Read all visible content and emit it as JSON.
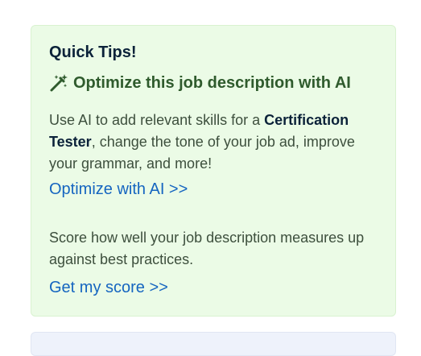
{
  "tips": {
    "title": "Quick Tips!",
    "optimize_heading": "Optimize this job description with AI",
    "optimize_icon": "magic-wand-icon",
    "ai_text_before": "Use AI to add relevant skills for a ",
    "ai_text_bold": "Certification Tester",
    "ai_text_after": ", change the tone of your job ad, improve your grammar, and more!",
    "optimize_link": "Optimize with AI >>",
    "score_text": "Score how well your job description measures up against best practices.",
    "score_link": "Get my score >>"
  },
  "colors": {
    "card_background": "#ebfbe6",
    "heading": "#0b2239",
    "optimize_heading": "#2f5b2d",
    "link": "#1565c0",
    "next_card_background": "#eef2fb"
  }
}
